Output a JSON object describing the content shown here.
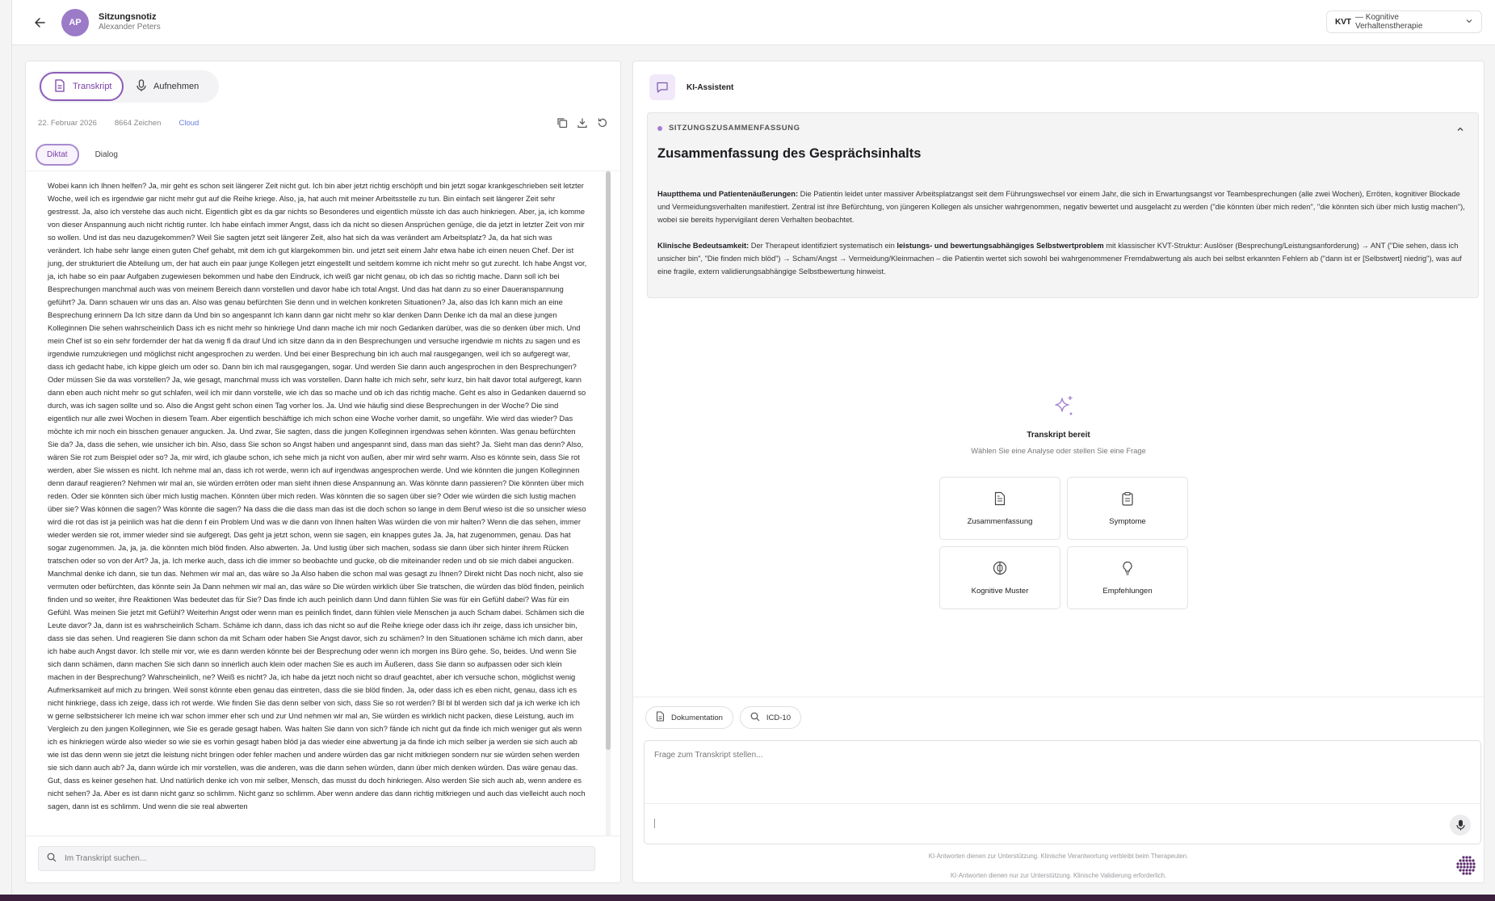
{
  "header": {
    "avatar_initials": "AP",
    "title": "Sitzungsnotiz",
    "subtitle": "Alexander Peters",
    "therapy_code": "KVT",
    "therapy_label": "— Kognitive Verhaltenstherapie"
  },
  "left": {
    "tabs": [
      "Transkript",
      "Aufnehmen"
    ],
    "date": "22. Februar 2026",
    "chars": "8664 Zeichen",
    "storage": "Cloud",
    "subtabs": [
      "Diktat",
      "Dialog"
    ],
    "transcript": "Wobei kann ich Ihnen helfen? Ja, mir geht es schon seit längerer Zeit nicht gut. Ich bin aber jetzt richtig erschöpft und bin jetzt sogar krankgeschrieben seit letzter Woche, weil ich es irgendwie gar nicht mehr gut auf die Reihe kriege. Also, ja, hat auch mit meiner Arbeitsstelle zu tun. Bin einfach seit längerer Zeit sehr gestresst. Ja, also ich verstehe das auch nicht. Eigentlich gibt es da gar nichts so Besonderes und eigentlich müsste ich das auch hinkriegen. Aber, ja, ich komme von dieser Anspannung auch nicht richtig runter. Ich habe einfach immer Angst, dass ich da nicht so diesen Ansprüchen genüge, die da jetzt in letzter Zeit von mir so wollen. Und ist das neu dazugekommen? Weil Sie sagten jetzt seit längerer Zeit, also hat sich da was verändert am Arbeitsplatz? Ja, da hat sich was verändert. Ich habe sehr lange einen guten Chef gehabt, mit dem ich gut klargekommen bin. und jetzt seit einem Jahr etwa habe ich einen neuen Chef. Der ist jung, der strukturiert die Abteilung um, der hat auch ein paar junge Kollegen jetzt eingestellt und seitdem komme ich nicht mehr so gut zurecht. Ich habe Angst vor, ja, ich habe so ein paar Aufgaben zugewiesen bekommen und habe den Eindruck, ich weiß gar nicht genau, ob ich das so richtig mache. Dann soll ich bei Besprechungen manchmal auch was von meinem Bereich dann vorstellen und davor habe ich total Angst. Und das hat dann zu so einer Daueranspannung geführt? Ja. Dann schauen wir uns das an. Also was genau befürchten Sie denn und in welchen konkreten Situationen? Ja, also das Ich kann mich an eine Besprechung erinnern Da Ich sitze dann da Und bin so angespannt Ich kann dann gar nicht mehr so klar denken Dann Denke ich da mal an diese jungen Kolleginnen Die sehen wahrscheinlich Dass ich es nicht mehr so hinkriege Und dann mache ich mir noch Gedanken darüber, was die so denken über mich. Und mein Chef ist so ein sehr fordernder der hat da wenig fl da drauf Und ich sitze dann da in den Besprechungen und versuche irgendwie m nichts zu sagen und es irgendwie rumzukriegen und möglichst nicht angesprochen zu werden. Und bei einer Besprechung bin ich auch mal rausgegangen, weil ich so aufgeregt war, dass ich gedacht habe, ich kippe gleich um oder so. Dann bin ich mal rausgegangen, sogar. Und werden Sie dann auch angesprochen in den Besprechungen? Oder müssen Sie da was vorstellen? Ja, wie gesagt, manchmal muss ich was vorstellen. Dann halte ich mich sehr, sehr kurz, bin halt davor total aufgeregt, kann dann eben auch nicht mehr so gut schlafen, weil ich mir dann vorstelle, wie ich das so mache und ob ich das richtig mache. Geht es also in Gedanken dauernd so durch, was ich sagen sollte und so. Also die Angst geht schon einen Tag vorher los. Ja. Und wie häufig sind diese Besprechungen in der Woche? Die sind eigentlich nur alle zwei Wochen in diesem Team. Aber eigentlich beschäftige ich mich schon eine Woche vorher damit, so ungefähr. Wie wird das wieder? Das möchte ich mir noch ein bisschen genauer angucken. Ja. Und zwar, Sie sagten, dass die jungen Kolleginnen irgendwas sehen könnten. Was genau befürchten Sie da? Ja, dass die sehen, wie unsicher ich bin. Also, dass Sie schon so Angst haben und angespannt sind, dass man das sieht? Ja. Sieht man das denn? Also, wären Sie rot zum Beispiel oder so? Ja, mir wird, ich glaube schon, ich sehe mich ja nicht von außen, aber mir wird sehr warm. Also es könnte sein, dass Sie rot werden, aber Sie wissen es nicht. Ich nehme mal an, dass ich rot werde, wenn ich auf irgendwas angesprochen werde. Und wie könnten die jungen Kolleginnen denn darauf reagieren? Nehmen wir mal an, sie würden erröten oder man sieht ihnen diese Anspannung an. Was könnte dann passieren? Die könnten über mich reden. Oder sie könnten sich über mich lustig machen. Könnten über mich reden. Was könnten die so sagen über sie? Oder wie würden die sich lustig machen über sie? Was können die sagen? Was könnte die sagen? Na dass die die dass man das ist die doch schon so lange in dem Beruf wieso ist die so unsicher wieso wird die rot das ist ja peinlich was hat die denn f ein Problem Und was w die dann von Ihnen halten Was würden die von mir halten? Wenn die das sehen, immer wieder werden sie rot, immer wieder sind sie aufgeregt. Das geht ja jetzt schon, wenn sie sagen, ein knappes gutes Ja. Ja, hat zugenommen, genau. Das hat sogar zugenommen. Ja, ja, ja. die könnten mich blöd finden. Also abwerten. Ja. Und lustig über sich machen, sodass sie dann über sich hinter ihrem Rücken tratschen oder so von der Art? Ja, ja. Ich merke auch, dass ich die immer so beobachte und gucke, ob die miteinander reden und ob sie mich dabei angucken. Manchmal denke ich dann, sie tun das. Nehmen wir mal an, das wäre so Ja Also haben die schon mal was gesagt zu Ihnen? Direkt nicht Das noch nicht, also sie vermuten oder befürchten, das könnte sein Ja Dann nehmen wir mal an, das wäre so Die würden wirklich über Sie tratschen, die würden das blöd finden, peinlich finden und so weiter, ihre Reaktionen Was bedeutet das für Sie? Das finde ich auch peinlich dann Und dann fühlen Sie was für ein Gefühl dabei? Was für ein Gefühl. Was meinen Sie jetzt mit Gefühl? Weiterhin Angst oder wenn man es peinlich findet, dann fühlen viele Menschen ja auch Scham dabei. Schämen sich die Leute davor? Ja, dann ist es wahrscheinlich Scham. Schäme ich dann, dass ich das nicht so auf die Reihe kriege oder dass ich ihr zeige, dass ich unsicher bin, dass sie das sehen. Und reagieren Sie dann schon da mit Scham oder haben Sie Angst davor, sich zu schämen? In den Situationen schäme ich mich dann, aber ich habe auch Angst davor. Ich stelle mir vor, wie es dann werden könnte bei der Besprechung oder wenn ich morgen ins Büro gehe. So, beides. Und wenn Sie sich dann schämen, dann machen Sie sich dann so innerlich auch klein oder machen Sie es auch im Äußeren, dass Sie dann so aufpassen oder sich klein machen in der Besprechung? Wahrscheinlich, ne? Weiß es nicht? Ja, ich habe da jetzt noch nicht so drauf geachtet, aber ich versuche schon, möglichst wenig Aufmerksamkeit auf mich zu bringen. Weil sonst könnte eben genau das eintreten, dass die sie blöd finden. Ja, oder dass ich es eben nicht, genau, dass ich es nicht hinkriege, dass ich zeige, dass ich rot werde. Wie finden Sie das denn selber von sich, dass Sie so rot werden? Bl bl bl werden sich daf ja ich werke ich ich w gerne selbstsicherer Ich meine ich war schon immer eher sch und zur Und nehmen wir mal an, Sie würden es wirklich nicht packen, diese Leistung, auch im Vergleich zu den jungen Kolleginnen, wie Sie es gerade gesagt haben. Was halten Sie dann von sich? fände ich nicht gut da finde ich mich weniger gut als wenn ich es hinkriegen würde also wieder so wie sie es vorhin gesagt haben blöd ja das wieder eine abwertung ja da finde ich mich selber ja werden sie sich auch ab wie ist das denn wenn sie jetzt die leistung nicht bringen oder fehler machen und andere würden das gar nicht mitkriegen sondern nur sie würden sehen werden sie sich dann auch ab? Ja, dann würde ich mir vorstellen, was die anderen, was die dann sehen würden, dann über mich denken würden. Das wäre genau das. Gut, dass es keiner gesehen hat. Und natürlich denke ich von mir selber, Mensch, das musst du doch hinkriegen. Also werden Sie sich auch ab, wenn andere es nicht sehen? Ja. Aber es ist dann nicht ganz so schlimm. Nicht ganz so schlimm. Aber wenn andere das dann richtig mitkriegen und auch das vielleicht auch noch sagen, dann ist es schlimm. Und wenn die sie real abwerten",
    "search_placeholder": "Im Transkript suchen..."
  },
  "right": {
    "assistant_title": "KI-Assistent",
    "summary_label": "SITZUNGSZUSAMMENFASSUNG",
    "summary_title": "Zusammenfassung des Gesprächsinhalts",
    "p1_bold": "Hauptthema und Patientenäußerungen:",
    "p1_text": " Die Patientin leidet unter massiver Arbeitsplatzangst seit dem Führungswechsel vor einem Jahr, die sich in Erwartungsangst vor Teambesprechungen (alle zwei Wochen), Erröten, kognitiver Blockade und Vermeidungsverhalten manifestiert. Zentral ist ihre Befürchtung, von jüngeren Kollegen als unsicher wahrgenommen, negativ bewertet und ausgelacht zu werden (\"die könnten über mich reden\", \"die könnten sich über mich lustig machen\"), wobei sie bereits hypervigilant deren Verhalten beobachtet.",
    "p2_bold": "Klinische Bedeutsamkeit:",
    "p2_text_a": " Der Therapeut identifiziert systematisch ein ",
    "p2_bold_b": "leistungs- und bewertungsabhängiges Selbstwertproblem",
    "p2_text_c": " mit klassischer KVT-Struktur: Auslöser (Besprechung/Leistungsanforderung) → ANT (\"Die sehen, dass ich unsicher bin\", \"Die finden mich blöd\") → Scham/Angst → Vermeidung/Kleinmachen – die Patientin wertet sich sowohl bei wahrgenommener Fremdabwertung als auch bei selbst erkannten Fehlern ab (\"dann ist er [Selbstwert] niedrig\"), was auf eine fragile, extern validierungsabhängige Selbstbewertung hinweist.",
    "ready_title": "Transkript bereit",
    "ready_sub": "Wählen Sie eine Analyse oder stellen Sie eine Frage",
    "actions": [
      "Zusammenfassung",
      "Symptome",
      "Kognitive Muster",
      "Empfehlungen"
    ],
    "chips": [
      "Dokumentation",
      "ICD-10"
    ],
    "question_placeholder": "Frage zum Transkript stellen...",
    "disclaimer1": "KI-Antworten dienen zur Unterstützung. Klinische Verantwortung verbleibt beim Therapeuten.",
    "disclaimer2": "KI-Antworten dienen nur zur Unterstützung. Klinische Validierung erforderlich."
  },
  "colors": {
    "accent": "#8e5bb8",
    "avatar": "#9b7bc8",
    "cloud": "#6a7fe0"
  }
}
